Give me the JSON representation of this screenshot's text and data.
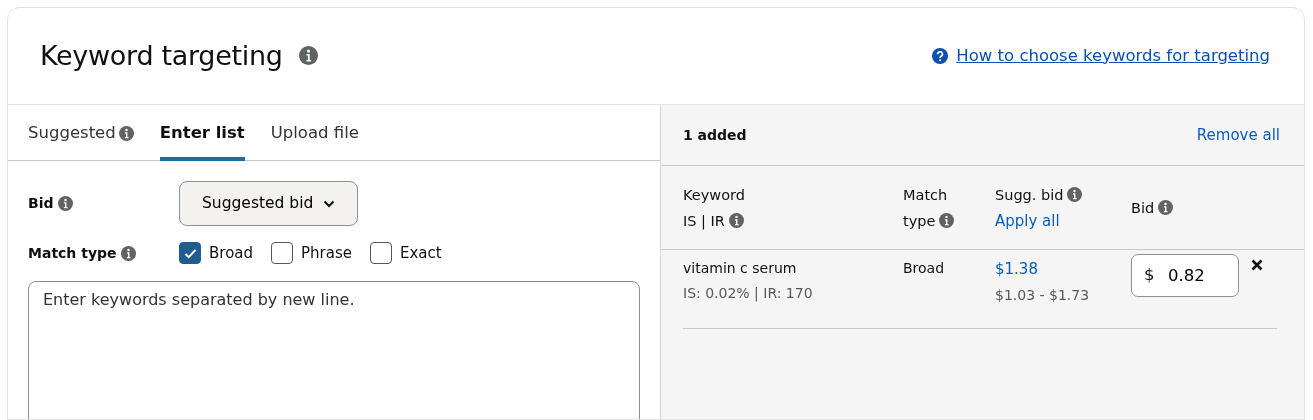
{
  "title": "Keyword targeting",
  "help_link": "How to choose keywords for targeting",
  "tabs": [
    {
      "label": "Suggested",
      "selected": false,
      "info_icon": true
    },
    {
      "label": "Enter list",
      "selected": true,
      "info_icon": false
    },
    {
      "label": "Upload file",
      "selected": false,
      "info_icon": false
    }
  ],
  "bid": {
    "label": "Bid",
    "value": "Suggested bid"
  },
  "match_type": {
    "label": "Match type",
    "options": [
      {
        "label": "Broad",
        "checked": true
      },
      {
        "label": "Phrase",
        "checked": false
      },
      {
        "label": "Exact",
        "checked": false
      }
    ]
  },
  "keywords_input": {
    "placeholder": "Enter keywords separated by new line."
  },
  "added": {
    "count_label": "1 added",
    "remove_all": "Remove all",
    "columns": [
      {
        "lines": [
          "Keyword",
          "IS | IR"
        ]
      },
      {
        "lines": [
          "Match",
          "type"
        ]
      },
      {
        "lines": [
          "Sugg. bid"
        ],
        "link": "Apply all"
      },
      {
        "lines": [
          "Bid"
        ]
      }
    ],
    "rows": [
      {
        "keyword": "vitamin c serum",
        "stats": "IS: 0.02% | IR: 170",
        "match_type": "Broad",
        "sugg_bid": "$1.38",
        "range": "$1.03 - $1.73",
        "currency": "$",
        "bid": "0.82"
      }
    ]
  }
}
